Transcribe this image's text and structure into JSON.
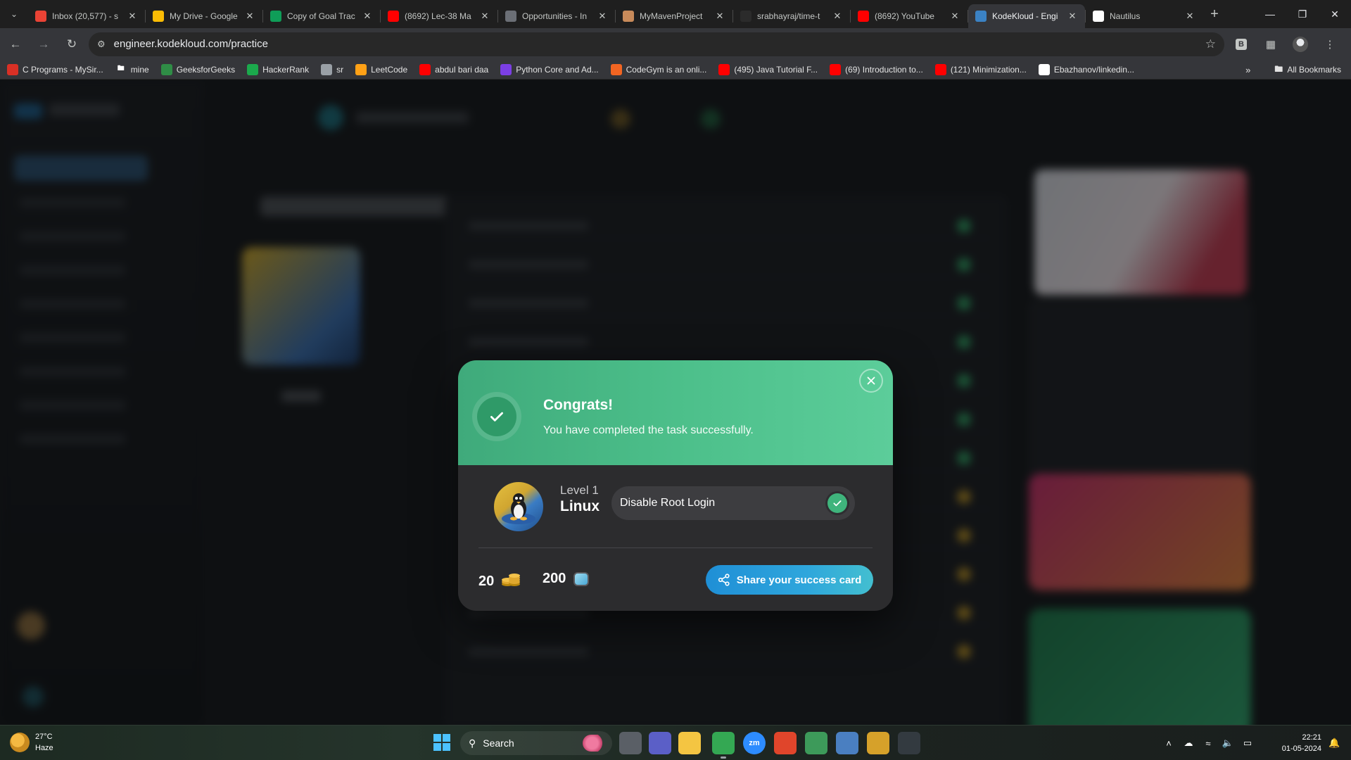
{
  "browser": {
    "tabs": [
      {
        "title": "Inbox (20,577) - s",
        "favicon_color": "#ea4335",
        "active": false
      },
      {
        "title": "My Drive - Google",
        "favicon_color": "#fbbc04",
        "active": false
      },
      {
        "title": "Copy of Goal Trac",
        "favicon_color": "#0f9d58",
        "active": false
      },
      {
        "title": "(8692) Lec-38 Ma",
        "favicon_color": "#ff0000",
        "active": false
      },
      {
        "title": "Opportunities - In",
        "favicon_color": "#6b6f76",
        "active": false
      },
      {
        "title": "MyMavenProject",
        "favicon_color": "#c88a5a",
        "active": false
      },
      {
        "title": "srabhayraj/time-t",
        "favicon_color": "#2b2b2b",
        "active": false
      },
      {
        "title": "(8692) YouTube",
        "favicon_color": "#ff0000",
        "active": false
      },
      {
        "title": "KodeKloud - Engi",
        "favicon_color": "#3b82c4",
        "active": true
      },
      {
        "title": "Nautilus",
        "favicon_color": "#ffffff",
        "active": false
      }
    ],
    "url": "engineer.kodekloud.com/practice",
    "bookmarks": [
      {
        "label": "C Programs - MySir...",
        "icon_color": "#d93025"
      },
      {
        "label": "mine",
        "icon_color": "folder"
      },
      {
        "label": "GeeksforGeeks",
        "icon_color": "#2f8d46"
      },
      {
        "label": "HackerRank",
        "icon_color": "#1ba94c"
      },
      {
        "label": "sr",
        "icon_color": "#9aa0a6"
      },
      {
        "label": "LeetCode",
        "icon_color": "#ffa116"
      },
      {
        "label": "abdul bari daa",
        "icon_color": "#ff0000"
      },
      {
        "label": "Python Core and Ad...",
        "icon_color": "#7b3fe4"
      },
      {
        "label": "CodeGym is an onli...",
        "icon_color": "#f26522"
      },
      {
        "label": "(495) Java Tutorial F...",
        "icon_color": "#ff0000"
      },
      {
        "label": "(69) Introduction to...",
        "icon_color": "#ff0000"
      },
      {
        "label": "(121) Minimization...",
        "icon_color": "#ff0000"
      },
      {
        "label": "Ebazhanov/linkedin...",
        "icon_color": "#ffffff"
      }
    ],
    "all_bookmarks": "All Bookmarks",
    "ext_badge": "B"
  },
  "modal": {
    "title": "Congrats!",
    "subtitle": "You have completed the task successfully.",
    "level": "Level 1",
    "course": "Linux",
    "task": "Disable Root Login",
    "coins": "20",
    "gems": "200",
    "share_label": "Share your success card",
    "accent_color": "#4cbf8a"
  },
  "taskbar": {
    "weather_temp": "27°C",
    "weather_desc": "Haze",
    "search_label": "Search",
    "time": "22:21",
    "date": "01-05-2024",
    "apps": [
      {
        "name": "task-view",
        "color": "#5a5f66"
      },
      {
        "name": "teams",
        "color": "#5b5fc7"
      },
      {
        "name": "file-explorer",
        "color": "#f4c542"
      },
      {
        "name": "chrome",
        "color": "#34a853"
      },
      {
        "name": "zoom",
        "color": "#2d8cff",
        "label": "zm"
      },
      {
        "name": "recorder",
        "color": "#e0452b"
      },
      {
        "name": "notepad",
        "color": "#3d9a5a"
      },
      {
        "name": "task-manager",
        "color": "#4a7fc1"
      },
      {
        "name": "widgets-app",
        "color": "#d6a12a"
      },
      {
        "name": "terminal",
        "color": "#333a40"
      }
    ]
  }
}
